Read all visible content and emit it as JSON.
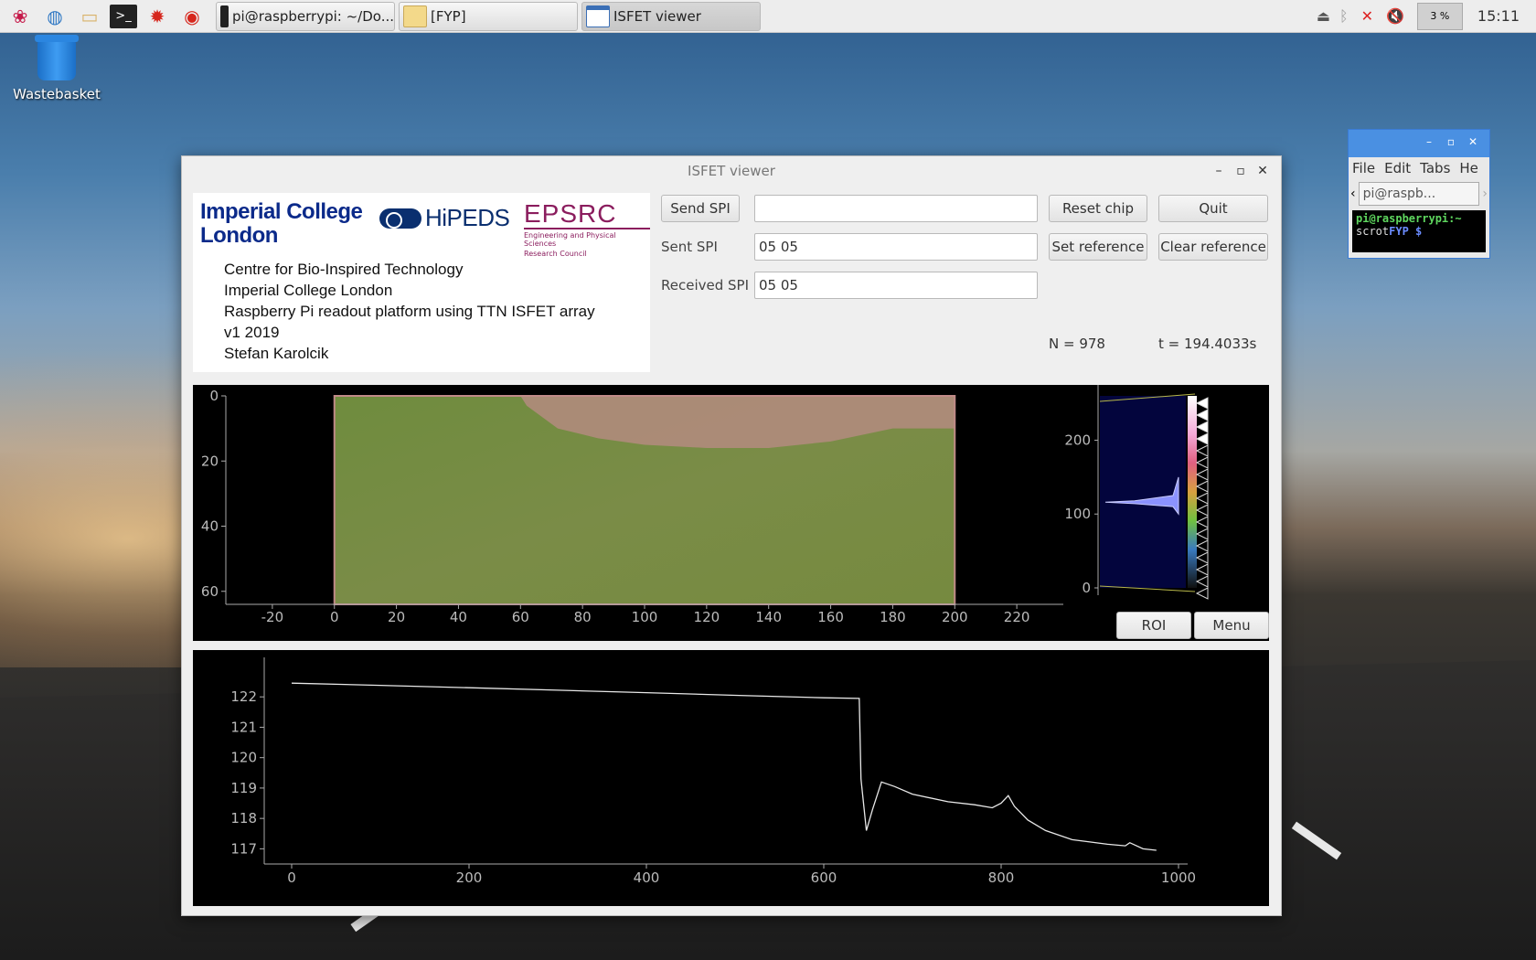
{
  "taskbar": {
    "tasks": [
      {
        "label": "pi@raspberrypi: ~/Do..."
      },
      {
        "label": "[FYP]"
      },
      {
        "label": "ISFET viewer"
      }
    ],
    "cpu_label": "3 %",
    "clock": "15:11"
  },
  "desktop": {
    "wastebasket_label": "Wastebasket"
  },
  "terminal": {
    "menu": [
      "File",
      "Edit",
      "Tabs",
      "He"
    ],
    "tab_label": "pi@raspb...",
    "prompt": "pi@raspberrypi:~",
    "command_prefix": "scrot",
    "command_suffix": "FYP $"
  },
  "window": {
    "title": "ISFET viewer"
  },
  "logos": {
    "imperial_line1": "Imperial College",
    "imperial_line2": "London",
    "hipeds": "HiPEDS",
    "epsrc": "EPSRC",
    "epsrc_sub1": "Engineering and Physical Sciences",
    "epsrc_sub2": "Research Council"
  },
  "info": {
    "lines": [
      "Centre for Bio-Inspired Technology",
      "Imperial College London",
      "Raspberry Pi readout platform using TTN ISFET array",
      "v1 2019",
      "Stefan Karolcik"
    ]
  },
  "controls": {
    "send_spi": "Send SPI",
    "send_spi_value": "",
    "reset_chip": "Reset chip",
    "quit": "Quit",
    "sent_spi_label": "Sent SPI",
    "sent_spi_value": "05 05",
    "set_reference": "Set reference",
    "clear_reference": "Clear reference",
    "received_spi_label": "Received SPI",
    "received_spi_value": "05 05",
    "n_label": "N = 978",
    "t_label": "t = 194.4033s",
    "roi": "ROI",
    "menu": "Menu"
  },
  "chart_data": [
    {
      "type": "heatmap",
      "title": "",
      "xlim": [
        -35,
        235
      ],
      "ylim": [
        0,
        64
      ],
      "x_ticks": [
        -20,
        0,
        20,
        40,
        60,
        80,
        100,
        120,
        140,
        160,
        180,
        200,
        220
      ],
      "y_ticks": [
        0,
        20,
        40,
        60
      ],
      "image_extent_x": [
        0,
        200
      ],
      "image_extent_y": [
        0,
        64
      ],
      "colormap_hint": "green body with pink upper-right region",
      "histogram_ticks": [
        0,
        100,
        200
      ]
    },
    {
      "type": "line",
      "title": "",
      "xlabel": "",
      "ylabel": "",
      "xlim": [
        0,
        1000
      ],
      "ylim": [
        116.5,
        123.3
      ],
      "x_ticks": [
        0,
        200,
        400,
        600,
        800,
        1000
      ],
      "y_ticks": [
        117,
        118,
        119,
        120,
        121,
        122
      ],
      "series": [
        {
          "x": [
            0,
            100,
            200,
            300,
            400,
            500,
            600,
            640,
            642,
            648,
            655,
            665,
            680,
            700,
            740,
            770,
            790,
            800,
            808,
            815,
            830,
            850,
            880,
            920,
            940,
            945,
            960,
            975
          ],
          "y": [
            122.45,
            122.38,
            122.3,
            122.22,
            122.14,
            122.05,
            121.97,
            121.95,
            119.3,
            117.6,
            118.3,
            119.2,
            119.05,
            118.8,
            118.55,
            118.45,
            118.35,
            118.5,
            118.75,
            118.4,
            117.95,
            117.6,
            117.3,
            117.15,
            117.1,
            117.2,
            117.0,
            116.95
          ]
        }
      ]
    }
  ]
}
